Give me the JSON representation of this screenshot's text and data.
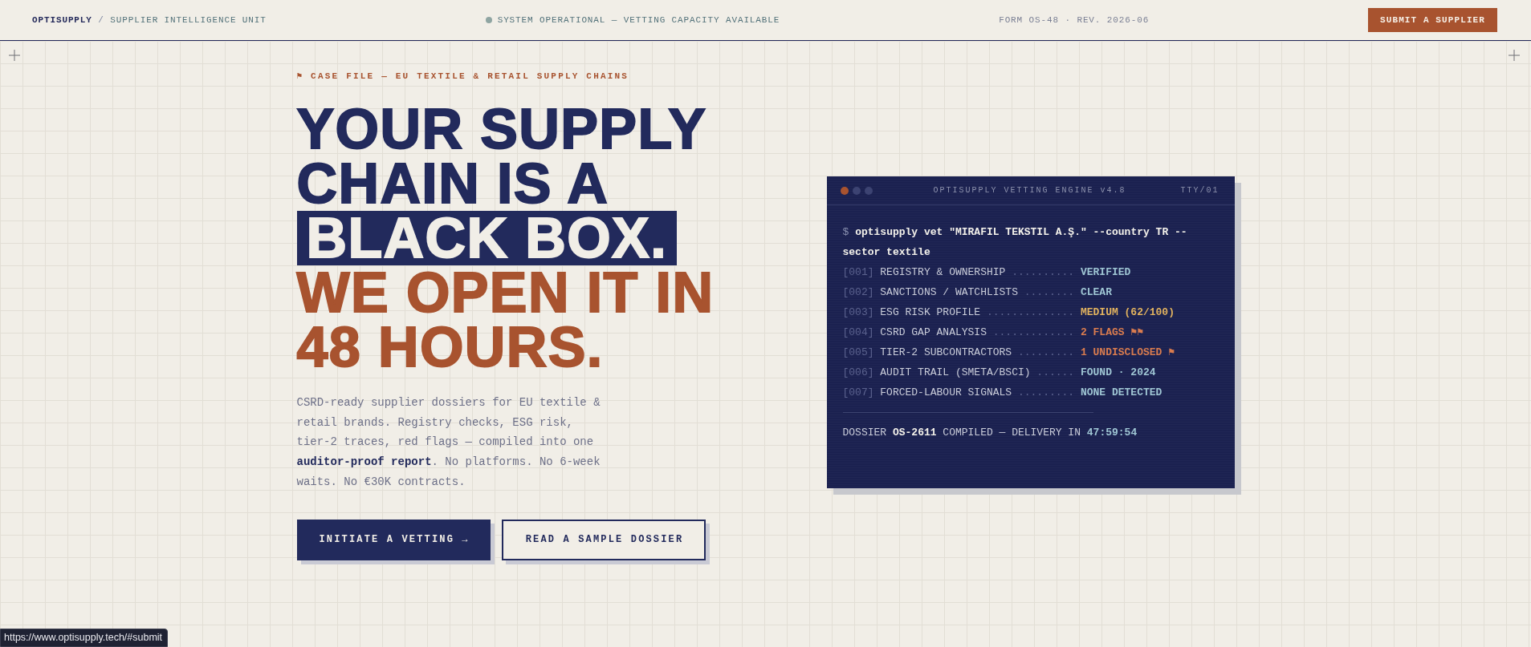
{
  "header": {
    "brand": "OPTISUPPLY",
    "separator": "/",
    "unit": "SUPPLIER INTELLIGENCE UNIT",
    "status": "SYSTEM OPERATIONAL — VETTING CAPACITY AVAILABLE",
    "form_ref": "FORM OS-48 · REV. 2026-06",
    "cta": "SUBMIT A SUPPLIER"
  },
  "hero": {
    "eyebrow": "⚑ CASE FILE — EU TEXTILE & RETAIL SUPPLY CHAINS",
    "headline": [
      {
        "text": "YOUR SUPPLY",
        "kind": "plain"
      },
      {
        "text": "CHAIN IS A",
        "kind": "plain"
      },
      {
        "text": "BLACK BOX.",
        "kind": "highlight"
      },
      {
        "text": "WE OPEN IT IN",
        "kind": "accent"
      },
      {
        "text": "48 HOURS.",
        "kind": "accent"
      }
    ],
    "body": "CSRD-ready supplier dossiers for EU textile & retail brands. Registry checks, ESG risk, tier-2 traces, red flags — compiled into one **auditor-proof report**. No platforms. No 6-week waits. No €30K contracts.",
    "buttons": [
      {
        "label": "INITIATE A VETTING →",
        "kind": "primary"
      },
      {
        "label": "READ A SAMPLE DOSSIER",
        "kind": "secondary"
      }
    ]
  },
  "terminal": {
    "title": "OPTISUPPLY VETTING ENGINE v4.8",
    "tty": "TTY/01",
    "prompt": "$",
    "command": "optisupply vet \"MIRAFIL TEKSTIL A.Ş.\" --country TR --sector textile",
    "checks": [
      {
        "index": "[001]",
        "label": "REGISTRY & OWNERSHIP",
        "leader": "..........",
        "value": "VERIFIED",
        "color": "#9fc6d4"
      },
      {
        "index": "[002]",
        "label": "SANCTIONS / WATCHLISTS",
        "leader": "........",
        "value": "CLEAR",
        "color": "#9fc6d4"
      },
      {
        "index": "[003]",
        "label": "ESG RISK PROFILE",
        "leader": "..............",
        "value": "MEDIUM (62/100)",
        "color": "#e2b35f"
      },
      {
        "index": "[004]",
        "label": "CSRD GAP ANALYSIS",
        "leader": ".............",
        "value": "2 FLAGS ⚑⚑",
        "color": "#d97c4f"
      },
      {
        "index": "[005]",
        "label": "TIER-2 SUBCONTRACTORS",
        "leader": ".........",
        "value": "1 UNDISCLOSED ⚑",
        "color": "#d97c4f"
      },
      {
        "index": "[006]",
        "label": "AUDIT TRAIL (SMETA/BSCI)",
        "leader": "......",
        "value": "FOUND · 2024",
        "color": "#9fc6d4"
      },
      {
        "index": "[007]",
        "label": "FORCED-LABOUR SIGNALS",
        "leader": ".........",
        "value": "NONE DETECTED",
        "color": "#9fc6d4"
      }
    ],
    "summary": {
      "prefix": "DOSSIER",
      "dossier_id": "OS-2611",
      "middle": "COMPILED — DELIVERY IN",
      "countdown": "47:59:54"
    }
  },
  "status_bar": {
    "url": "https://www.optisupply.tech/#submit"
  }
}
